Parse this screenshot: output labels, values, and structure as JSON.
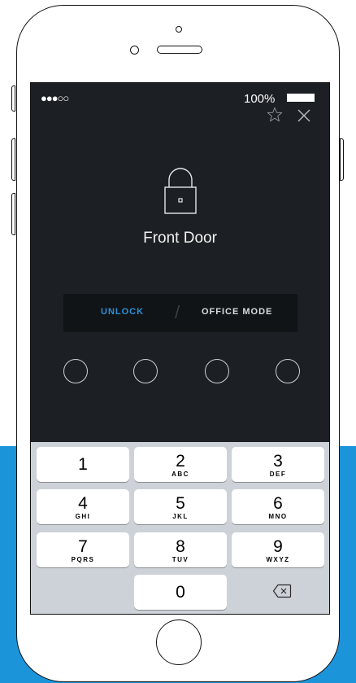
{
  "status": {
    "signal": "●●●○○",
    "battery_text": "100%"
  },
  "door": {
    "name": "Front Door"
  },
  "modes": {
    "unlock_label": "UNLOCK",
    "separator": "/",
    "office_label": "OFFICE MODE",
    "active": "unlock"
  },
  "pin": {
    "length": 4,
    "entered": 0
  },
  "keypad": {
    "keys": [
      {
        "num": "1",
        "letters": ""
      },
      {
        "num": "2",
        "letters": "ABC"
      },
      {
        "num": "3",
        "letters": "DEF"
      },
      {
        "num": "4",
        "letters": "GHI"
      },
      {
        "num": "5",
        "letters": "JKL"
      },
      {
        "num": "6",
        "letters": "MNO"
      },
      {
        "num": "7",
        "letters": "PQRS"
      },
      {
        "num": "8",
        "letters": "TUV"
      },
      {
        "num": "9",
        "letters": "WXYZ"
      },
      {
        "num": "0",
        "letters": ""
      }
    ]
  },
  "colors": {
    "screen_bg": "#1c1f23",
    "accent": "#2a8fd8",
    "background_band": "#1c94da",
    "keypad_bg": "#cdd2d8"
  },
  "icons": [
    "star-icon",
    "close-icon",
    "lock-icon",
    "backspace-icon"
  ]
}
